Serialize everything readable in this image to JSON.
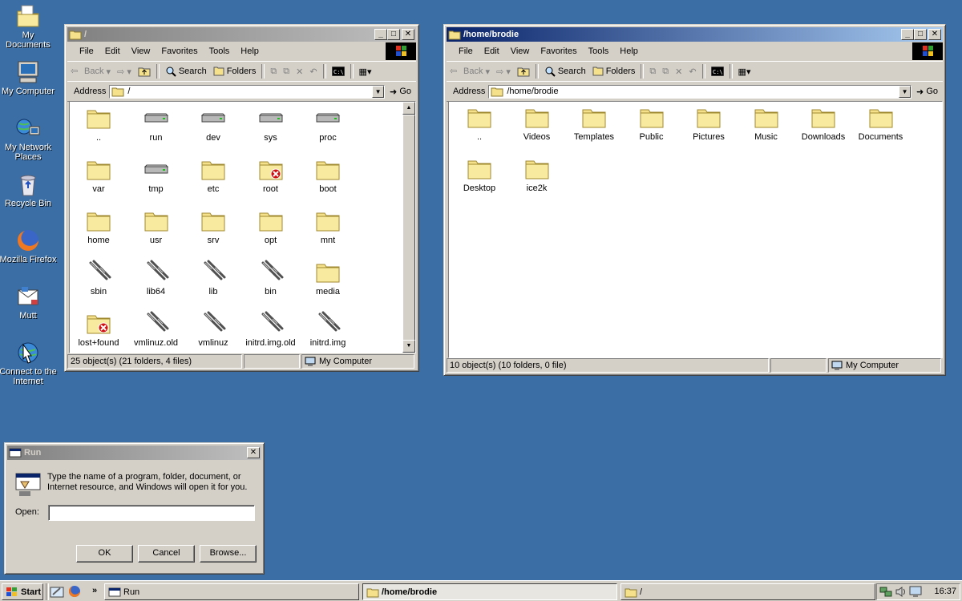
{
  "desktop": {
    "icons": [
      {
        "label": "My Documents",
        "icon": "my-documents-icon"
      },
      {
        "label": "My Computer",
        "icon": "my-computer-icon"
      },
      {
        "label": "My Network Places",
        "icon": "network-places-icon"
      },
      {
        "label": "Recycle Bin",
        "icon": "recycle-bin-icon"
      },
      {
        "label": "Mozilla Firefox",
        "icon": "firefox-icon"
      },
      {
        "label": "Mutt",
        "icon": "mutt-mail-icon"
      },
      {
        "label": "Connect to the Internet",
        "icon": "connect-internet-icon"
      }
    ]
  },
  "explorer_common": {
    "menus": [
      "File",
      "Edit",
      "View",
      "Favorites",
      "Tools",
      "Help"
    ],
    "back": "Back",
    "search": "Search",
    "folders": "Folders",
    "address_label": "Address",
    "go": "Go",
    "computer_zone": "My Computer"
  },
  "window_root": {
    "title": "/",
    "address": "/",
    "status": "25 object(s) (21 folders, 4 files)",
    "items": [
      {
        "name": "..",
        "type": "folder"
      },
      {
        "name": "run",
        "type": "drive"
      },
      {
        "name": "dev",
        "type": "drive"
      },
      {
        "name": "sys",
        "type": "drive"
      },
      {
        "name": "proc",
        "type": "drive"
      },
      {
        "name": "var",
        "type": "folder"
      },
      {
        "name": "tmp",
        "type": "drive"
      },
      {
        "name": "etc",
        "type": "folder"
      },
      {
        "name": "root",
        "type": "folder-locked"
      },
      {
        "name": "boot",
        "type": "folder"
      },
      {
        "name": "home",
        "type": "folder"
      },
      {
        "name": "usr",
        "type": "folder"
      },
      {
        "name": "srv",
        "type": "folder"
      },
      {
        "name": "opt",
        "type": "folder"
      },
      {
        "name": "mnt",
        "type": "folder"
      },
      {
        "name": "sbin",
        "type": "link"
      },
      {
        "name": "lib64",
        "type": "link"
      },
      {
        "name": "lib",
        "type": "link"
      },
      {
        "name": "bin",
        "type": "link"
      },
      {
        "name": "media",
        "type": "folder"
      },
      {
        "name": "lost+found",
        "type": "folder-locked"
      },
      {
        "name": "vmlinuz.old",
        "type": "link"
      },
      {
        "name": "vmlinuz",
        "type": "link"
      },
      {
        "name": "initrd.img.old",
        "type": "link"
      },
      {
        "name": "initrd.img",
        "type": "link"
      }
    ]
  },
  "window_home": {
    "title": "/home/brodie",
    "address": "/home/brodie",
    "status": "10 object(s) (10 folders, 0 file)",
    "items": [
      {
        "name": "..",
        "type": "folder"
      },
      {
        "name": "Videos",
        "type": "folder"
      },
      {
        "name": "Templates",
        "type": "folder"
      },
      {
        "name": "Public",
        "type": "folder"
      },
      {
        "name": "Pictures",
        "type": "folder"
      },
      {
        "name": "Music",
        "type": "folder"
      },
      {
        "name": "Downloads",
        "type": "folder"
      },
      {
        "name": "Documents",
        "type": "folder"
      },
      {
        "name": "Desktop",
        "type": "folder"
      },
      {
        "name": "ice2k",
        "type": "folder"
      }
    ]
  },
  "run_dialog": {
    "title": "Run",
    "description": "Type the name of a program, folder, document, or Internet resource, and Windows will open it for you.",
    "open_label": "Open:",
    "open_value": "",
    "ok": "OK",
    "cancel": "Cancel",
    "browse": "Browse..."
  },
  "taskbar": {
    "start": "Start",
    "overflow": "»",
    "tasks": [
      {
        "label": "Run",
        "active": false
      },
      {
        "label": "/home/brodie",
        "active": true
      },
      {
        "label": "/",
        "active": false
      }
    ],
    "clock": "16:37"
  },
  "colors": {
    "desktop": "#3a6ea5",
    "title_active": "#0a246a",
    "title_inactive": "#808080",
    "face": "#d4d0c8",
    "folder": "#f5e08c"
  }
}
